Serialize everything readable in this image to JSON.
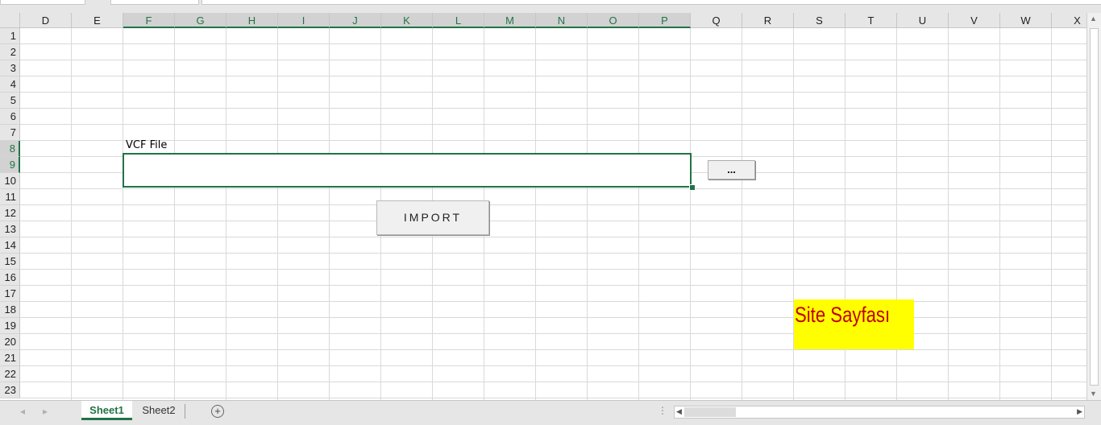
{
  "columns": [
    "D",
    "E",
    "F",
    "G",
    "H",
    "I",
    "J",
    "K",
    "L",
    "M",
    "N",
    "O",
    "P",
    "Q",
    "R",
    "S",
    "T",
    "U",
    "V",
    "W",
    "X"
  ],
  "rows": [
    "1",
    "2",
    "3",
    "4",
    "5",
    "6",
    "7",
    "8",
    "9",
    "10",
    "11",
    "12",
    "13",
    "14",
    "15",
    "16",
    "17",
    "18",
    "19",
    "20",
    "21",
    "22",
    "23"
  ],
  "selected_columns": [
    "F",
    "G",
    "H",
    "I",
    "J",
    "K",
    "L",
    "M",
    "N",
    "O",
    "P"
  ],
  "selected_rows": [
    "8",
    "9"
  ],
  "form": {
    "vcf_label": "VCF File",
    "vcf_value": "",
    "browse_label": "...",
    "import_label": "IMPORT"
  },
  "site_label": "Site Sayfası",
  "colors": {
    "accent": "#217346",
    "site_text": "#c00000",
    "site_background": "#ffff00"
  },
  "sheet_tabs": [
    {
      "label": "Sheet1",
      "active": true
    },
    {
      "label": "Sheet2",
      "active": false
    }
  ],
  "icons": {
    "prev_sheet": "triangle-left-icon",
    "next_sheet": "triangle-right-icon",
    "add_sheet": "plus-circle-icon",
    "scroll_left": "triangle-left-icon",
    "scroll_right": "triangle-right-icon",
    "scroll_up": "triangle-up-icon",
    "scroll_down": "triangle-down-icon"
  }
}
